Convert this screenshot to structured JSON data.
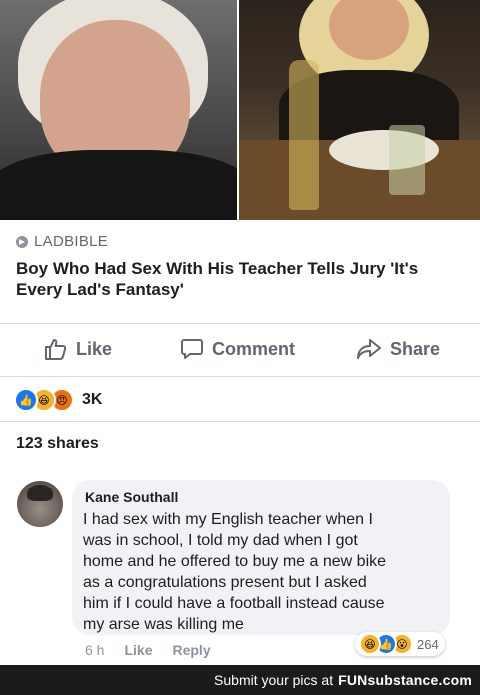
{
  "article": {
    "source": "LADBIBLE",
    "headline": "Boy Who Had Sex With His Teacher Tells Jury 'It's Every Lad's Fantasy'"
  },
  "actions": {
    "like": "Like",
    "comment": "Comment",
    "share": "Share"
  },
  "reactions": {
    "icons": [
      "like-icon",
      "haha-icon",
      "angry-icon"
    ],
    "count": "3K"
  },
  "shares": "123 shares",
  "comment": {
    "author": "Kane Southall",
    "text": "I had sex with my English teacher when I\nwas in school, I told my dad when I got\nhome and he offered to buy me a new bike\nas a congratulations present but I asked\nhim if I could have a football instead cause\nmy arse was killing me",
    "time": "6 h",
    "like": "Like",
    "reply": "Reply",
    "reaction_icons": [
      "haha-icon",
      "like-icon",
      "wow-icon"
    ],
    "reaction_count": "264"
  },
  "footer": {
    "text": "Submit your pics at",
    "brand": "FUNsubstance.com"
  },
  "colors": {
    "accent": "#1877f2",
    "text": "#1c1e21",
    "muted": "#606770",
    "bubble": "#f0f2f5"
  }
}
